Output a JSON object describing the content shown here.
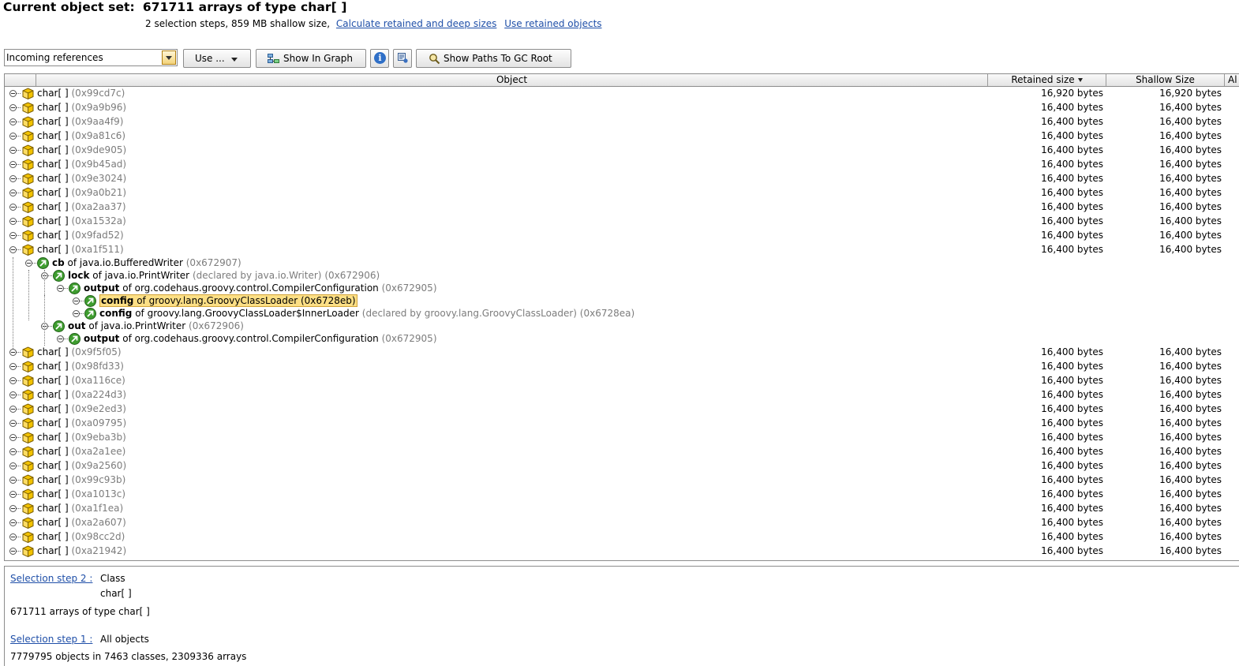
{
  "header": {
    "title_label": "Current object set:",
    "title_value": "671711 arrays of type char[ ]",
    "subtitle": "2 selection steps, 859 MB shallow size,",
    "link_calc": "Calculate retained and deep sizes",
    "link_use_retained": "Use retained objects"
  },
  "toolbar": {
    "view_selector": "Incoming references",
    "use_button": "Use ...",
    "show_in_graph": "Show In Graph",
    "show_paths": "Show Paths To GC Root",
    "icons": [
      "graph-icon",
      "info-icon",
      "list-settings-icon",
      "magnifier-gc-icon"
    ]
  },
  "table": {
    "columns": [
      "Object",
      "Retained size",
      "Shallow Size",
      "Al"
    ],
    "sort_column": "Retained size",
    "rows_top": [
      {
        "type": "char[ ]",
        "addr": "(0x99cd7c)",
        "retained": "16,920 bytes",
        "shallow": "16,920 bytes"
      },
      {
        "type": "char[ ]",
        "addr": "(0x9a9b96)",
        "retained": "16,400 bytes",
        "shallow": "16,400 bytes"
      },
      {
        "type": "char[ ]",
        "addr": "(0x9aa4f9)",
        "retained": "16,400 bytes",
        "shallow": "16,400 bytes"
      },
      {
        "type": "char[ ]",
        "addr": "(0x9a81c6)",
        "retained": "16,400 bytes",
        "shallow": "16,400 bytes"
      },
      {
        "type": "char[ ]",
        "addr": "(0x9de905)",
        "retained": "16,400 bytes",
        "shallow": "16,400 bytes"
      },
      {
        "type": "char[ ]",
        "addr": "(0x9b45ad)",
        "retained": "16,400 bytes",
        "shallow": "16,400 bytes"
      },
      {
        "type": "char[ ]",
        "addr": "(0x9e3024)",
        "retained": "16,400 bytes",
        "shallow": "16,400 bytes"
      },
      {
        "type": "char[ ]",
        "addr": "(0x9a0b21)",
        "retained": "16,400 bytes",
        "shallow": "16,400 bytes"
      },
      {
        "type": "char[ ]",
        "addr": "(0xa2aa37)",
        "retained": "16,400 bytes",
        "shallow": "16,400 bytes"
      },
      {
        "type": "char[ ]",
        "addr": "(0xa1532a)",
        "retained": "16,400 bytes",
        "shallow": "16,400 bytes"
      },
      {
        "type": "char[ ]",
        "addr": "(0x9fad52)",
        "retained": "16,400 bytes",
        "shallow": "16,400 bytes"
      },
      {
        "type": "char[ ]",
        "addr": "(0xa1f511)",
        "retained": "16,400 bytes",
        "shallow": "16,400 bytes"
      }
    ],
    "expanded": [
      {
        "field": "cb",
        "of": "of java.io.BufferedWriter",
        "extra": "",
        "addr": "(0x672907)"
      },
      {
        "field": "lock",
        "of": "of java.io.PrintWriter",
        "extra": "(declared by java.io.Writer)",
        "addr": "(0x672906)"
      },
      {
        "field": "output",
        "of": "of org.codehaus.groovy.control.CompilerConfiguration",
        "extra": "",
        "addr": "(0x672905)"
      },
      {
        "field": "config",
        "of": "of groovy.lang.GroovyClassLoader",
        "extra": "",
        "addr": "(0x6728eb)"
      },
      {
        "field": "config",
        "of": "of groovy.lang.GroovyClassLoader$InnerLoader",
        "extra": "(declared by groovy.lang.GroovyClassLoader)",
        "addr": "(0x6728ea)"
      },
      {
        "field": "out",
        "of": "of java.io.PrintWriter",
        "extra": "",
        "addr": "(0x672906)"
      },
      {
        "field": "output",
        "of": "of org.codehaus.groovy.control.CompilerConfiguration",
        "extra": "",
        "addr": "(0x672905)"
      }
    ],
    "rows_bottom": [
      {
        "type": "char[ ]",
        "addr": "(0x9f5f05)",
        "retained": "16,400 bytes",
        "shallow": "16,400 bytes"
      },
      {
        "type": "char[ ]",
        "addr": "(0x98fd33)",
        "retained": "16,400 bytes",
        "shallow": "16,400 bytes"
      },
      {
        "type": "char[ ]",
        "addr": "(0xa116ce)",
        "retained": "16,400 bytes",
        "shallow": "16,400 bytes"
      },
      {
        "type": "char[ ]",
        "addr": "(0xa224d3)",
        "retained": "16,400 bytes",
        "shallow": "16,400 bytes"
      },
      {
        "type": "char[ ]",
        "addr": "(0x9e2ed3)",
        "retained": "16,400 bytes",
        "shallow": "16,400 bytes"
      },
      {
        "type": "char[ ]",
        "addr": "(0xa09795)",
        "retained": "16,400 bytes",
        "shallow": "16,400 bytes"
      },
      {
        "type": "char[ ]",
        "addr": "(0x9eba3b)",
        "retained": "16,400 bytes",
        "shallow": "16,400 bytes"
      },
      {
        "type": "char[ ]",
        "addr": "(0xa2a1ee)",
        "retained": "16,400 bytes",
        "shallow": "16,400 bytes"
      },
      {
        "type": "char[ ]",
        "addr": "(0x9a2560)",
        "retained": "16,400 bytes",
        "shallow": "16,400 bytes"
      },
      {
        "type": "char[ ]",
        "addr": "(0x99c93b)",
        "retained": "16,400 bytes",
        "shallow": "16,400 bytes"
      },
      {
        "type": "char[ ]",
        "addr": "(0xa1013c)",
        "retained": "16,400 bytes",
        "shallow": "16,400 bytes"
      },
      {
        "type": "char[ ]",
        "addr": "(0xa1f1ea)",
        "retained": "16,400 bytes",
        "shallow": "16,400 bytes"
      },
      {
        "type": "char[ ]",
        "addr": "(0xa2a607)",
        "retained": "16,400 bytes",
        "shallow": "16,400 bytes"
      },
      {
        "type": "char[ ]",
        "addr": "(0x98cc2d)",
        "retained": "16,400 bytes",
        "shallow": "16,400 bytes"
      },
      {
        "type": "char[ ]",
        "addr": "(0xa21942)",
        "retained": "16,400 bytes",
        "shallow": "16,400 bytes"
      }
    ]
  },
  "selection": {
    "step2_link": "Selection step 2 :",
    "step2_kind": "Class",
    "step2_class": "char[ ]",
    "step2_summary": "671711 arrays of type char[ ]",
    "step1_link": "Selection step 1 :",
    "step1_kind": "All objects",
    "step1_summary": "7779795 objects in 7463 classes, 2309336 arrays"
  },
  "colors": {
    "link": "#1f4fa8",
    "highlight": "#fcdf85",
    "cube": "#f2c200",
    "gc_root_icon": "#3e9d2f",
    "address_gray": "#7c7c7c"
  }
}
